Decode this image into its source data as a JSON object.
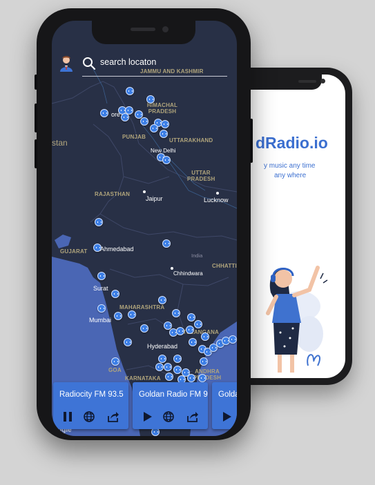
{
  "splash": {
    "brand": "dRadio.io",
    "tagline_line1": "y music any time",
    "tagline_line2": "any where"
  },
  "search": {
    "placeholder": "search locaton"
  },
  "map": {
    "region_labels": [
      "JAMMU AND KASHMIR",
      "HIMACHAL PRADESH",
      "PUNJAB",
      "UTTARAKHAND",
      "UTTAR PRADESH",
      "RAJASTHAN",
      "GUJARAT",
      "MAHARASHTRA",
      "TELANGANA",
      "KARNATAKA",
      "GOA",
      "ANDHRA PRADESH",
      "CHHATTI"
    ],
    "cities": [
      "New Delhi",
      "Jaipur",
      "Lucknow",
      "Ahmedabad",
      "Surat",
      "Mumbai",
      "Hyderabad",
      "Chhindwara"
    ],
    "country_labels": [
      "stan",
      "India"
    ],
    "partial_city": "ore",
    "attribution": "oogle"
  },
  "stations": [
    {
      "name": "Radiocity FM 93.5",
      "state": "playing"
    },
    {
      "name": "Goldan Radio FM 9...",
      "state": "paused"
    },
    {
      "name": "Golda",
      "state": "paused"
    }
  ],
  "colors": {
    "background": "#d4d4d4",
    "map": "#283046",
    "sea": "#4a66b4",
    "accent": "#3e74d6",
    "marker": "#3d7fe6",
    "label": "#b1a57c"
  }
}
